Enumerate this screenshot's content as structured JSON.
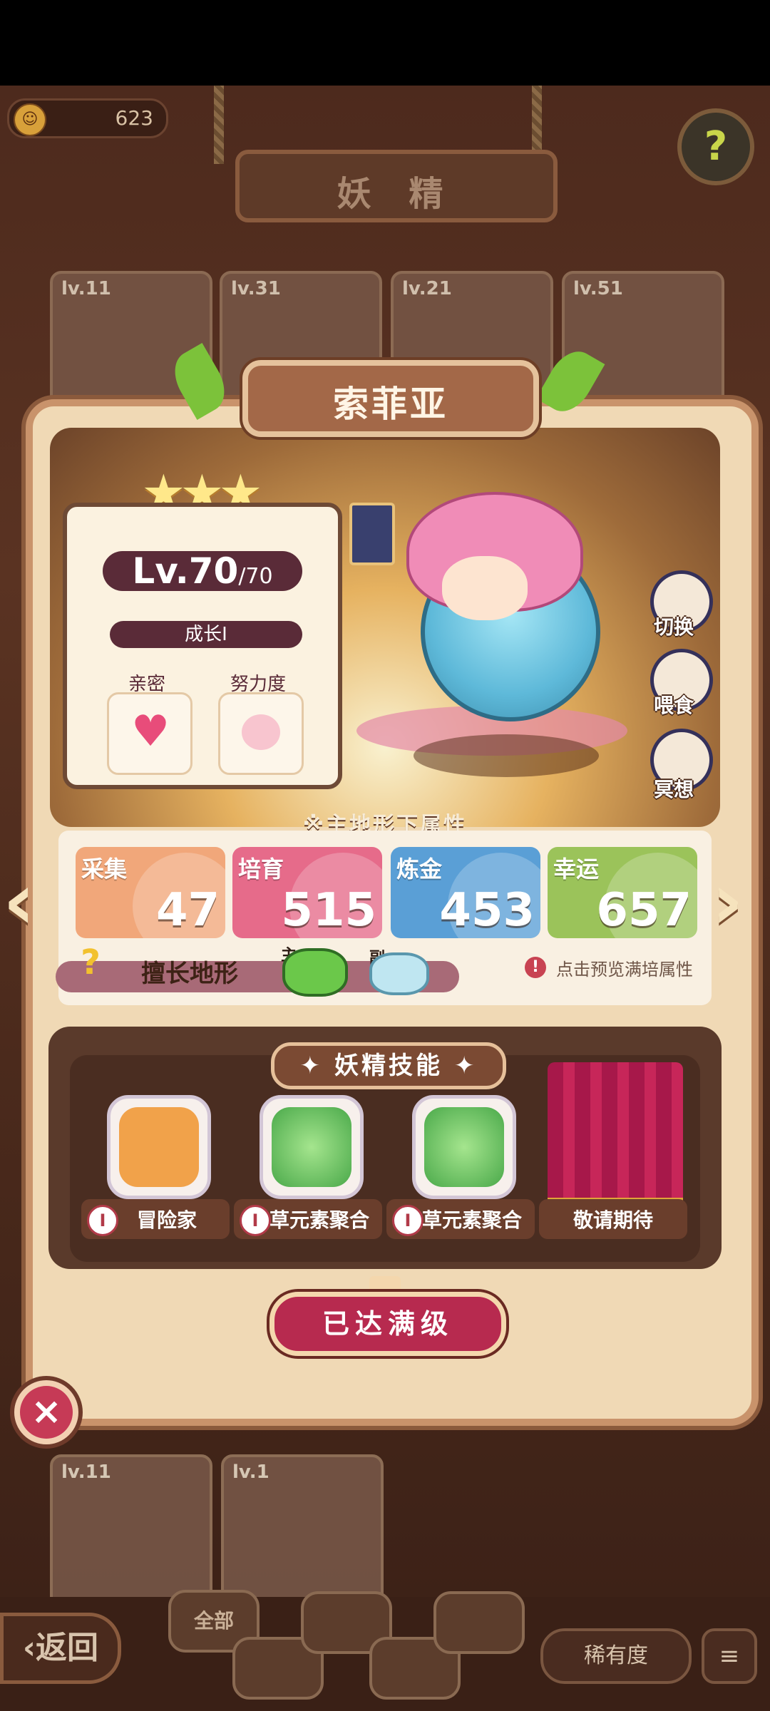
{
  "header": {
    "currency_amount": "623",
    "title": "妖 精",
    "help_icon": "?"
  },
  "background_cards": [
    {
      "level": "lv.11"
    },
    {
      "level": "lv.31"
    },
    {
      "level": "lv.21"
    },
    {
      "level": "lv.51"
    }
  ],
  "fairy": {
    "name": "索菲亚",
    "stars": 3,
    "level_current": "Lv.70",
    "level_max": "/70",
    "growth": "成长I",
    "intimacy_label": "亲密",
    "effort_label": "努力度"
  },
  "side_actions": [
    {
      "label": "切换"
    },
    {
      "label": "喂食"
    },
    {
      "label": "冥想"
    }
  ],
  "attributes": {
    "section_title": "※主地形下属性",
    "items": [
      {
        "name": "采集",
        "value": "47",
        "color": "#f1a77a"
      },
      {
        "name": "培育",
        "value": "515",
        "color": "#e66b8a"
      },
      {
        "name": "炼金",
        "value": "453",
        "color": "#5a9fd6"
      },
      {
        "name": "幸运",
        "value": "657",
        "color": "#9bc35a"
      }
    ],
    "terrain_label": "擅长地形",
    "main_tag": "主",
    "sub_tag": "副",
    "preview_text": "点击预览满培属性",
    "preview_mark": "!"
  },
  "skills": {
    "title": "✦ 妖精技能 ✦",
    "items": [
      {
        "label": "冒险家",
        "rank": "I"
      },
      {
        "label": "草元素聚合",
        "rank": "I"
      },
      {
        "label": "草元素聚合",
        "rank": "I"
      },
      {
        "label": "敬请期待",
        "rank": ""
      }
    ]
  },
  "max_level_button": "已达满级",
  "lower_cards": [
    {
      "level": "lv.11"
    },
    {
      "level": "lv.1"
    }
  ],
  "bottom_bar": {
    "back_label": "‹返回",
    "filter_all": "全部",
    "rarity_label": "稀有度",
    "sort_icon": "≡"
  },
  "close_icon": "×"
}
